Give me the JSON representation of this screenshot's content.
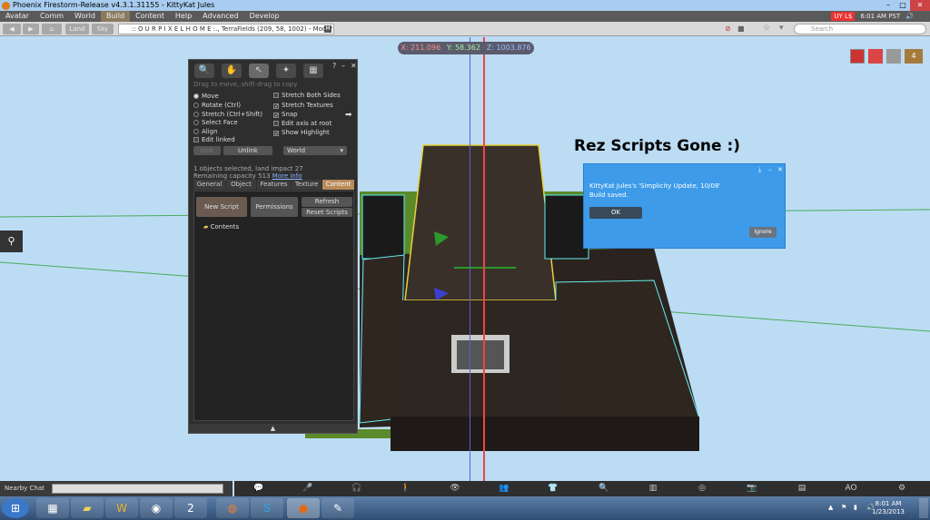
{
  "window": {
    "title": "Phoenix Firestorm-Release v4.3.1.31155 - KittyKat Jules"
  },
  "menu": {
    "items": [
      "Avatar",
      "Comm",
      "World",
      "Build",
      "Content",
      "Help",
      "Advanced",
      "Develop"
    ],
    "active": "Build",
    "balance": "UY L$",
    "time": "6:01 AM PST"
  },
  "nav": {
    "land": "Land",
    "sky": "Sky",
    "location": ":: O U R  P I X E L  H O M E :., TerraFields (209, 58, 1002) - Moderate",
    "maturity": "M",
    "search_placeholder": "Search"
  },
  "coords": {
    "x": "X: 211.096",
    "y": "Y: 58.362",
    "z": "Z: 1003.876"
  },
  "build": {
    "hint": "Drag to move, shift-drag to copy",
    "modes": [
      "Move",
      "Rotate (Ctrl)",
      "Stretch (Ctrl+Shift)",
      "Select Face",
      "Align",
      "Edit linked"
    ],
    "checks": [
      "Stretch Both Sides",
      "Stretch Textures",
      "Snap",
      "Edit axis at root",
      "Show Highlight"
    ],
    "link": "Link",
    "unlink": "Unlink",
    "world": "World",
    "status": "1 objects selected, land impact 27",
    "capacity": "Remaining capacity 513",
    "more": "More info",
    "tabs": [
      "General",
      "Object",
      "Features",
      "Texture",
      "Content"
    ],
    "active_tab": "Content",
    "new_script": "New Script",
    "permissions": "Permissions",
    "refresh": "Refresh",
    "reset_scripts": "Reset Scripts",
    "contents": "Contents"
  },
  "annotation": "Rez Scripts Gone :)",
  "dialog": {
    "line1": "KittyKat Jules's 'Simplicity Update, 10/08'",
    "line2": "Build saved.",
    "ok": "OK",
    "ignore": "Ignore"
  },
  "hud": {
    "count": "4"
  },
  "chat": {
    "label": "Nearby Chat"
  },
  "toolbar": {
    "ao": "AO"
  },
  "clock": {
    "time": "8:01 AM",
    "date": "1/23/2013"
  },
  "colors": {
    "accent": "#b88a5a",
    "dialog": "#3d9be9"
  }
}
